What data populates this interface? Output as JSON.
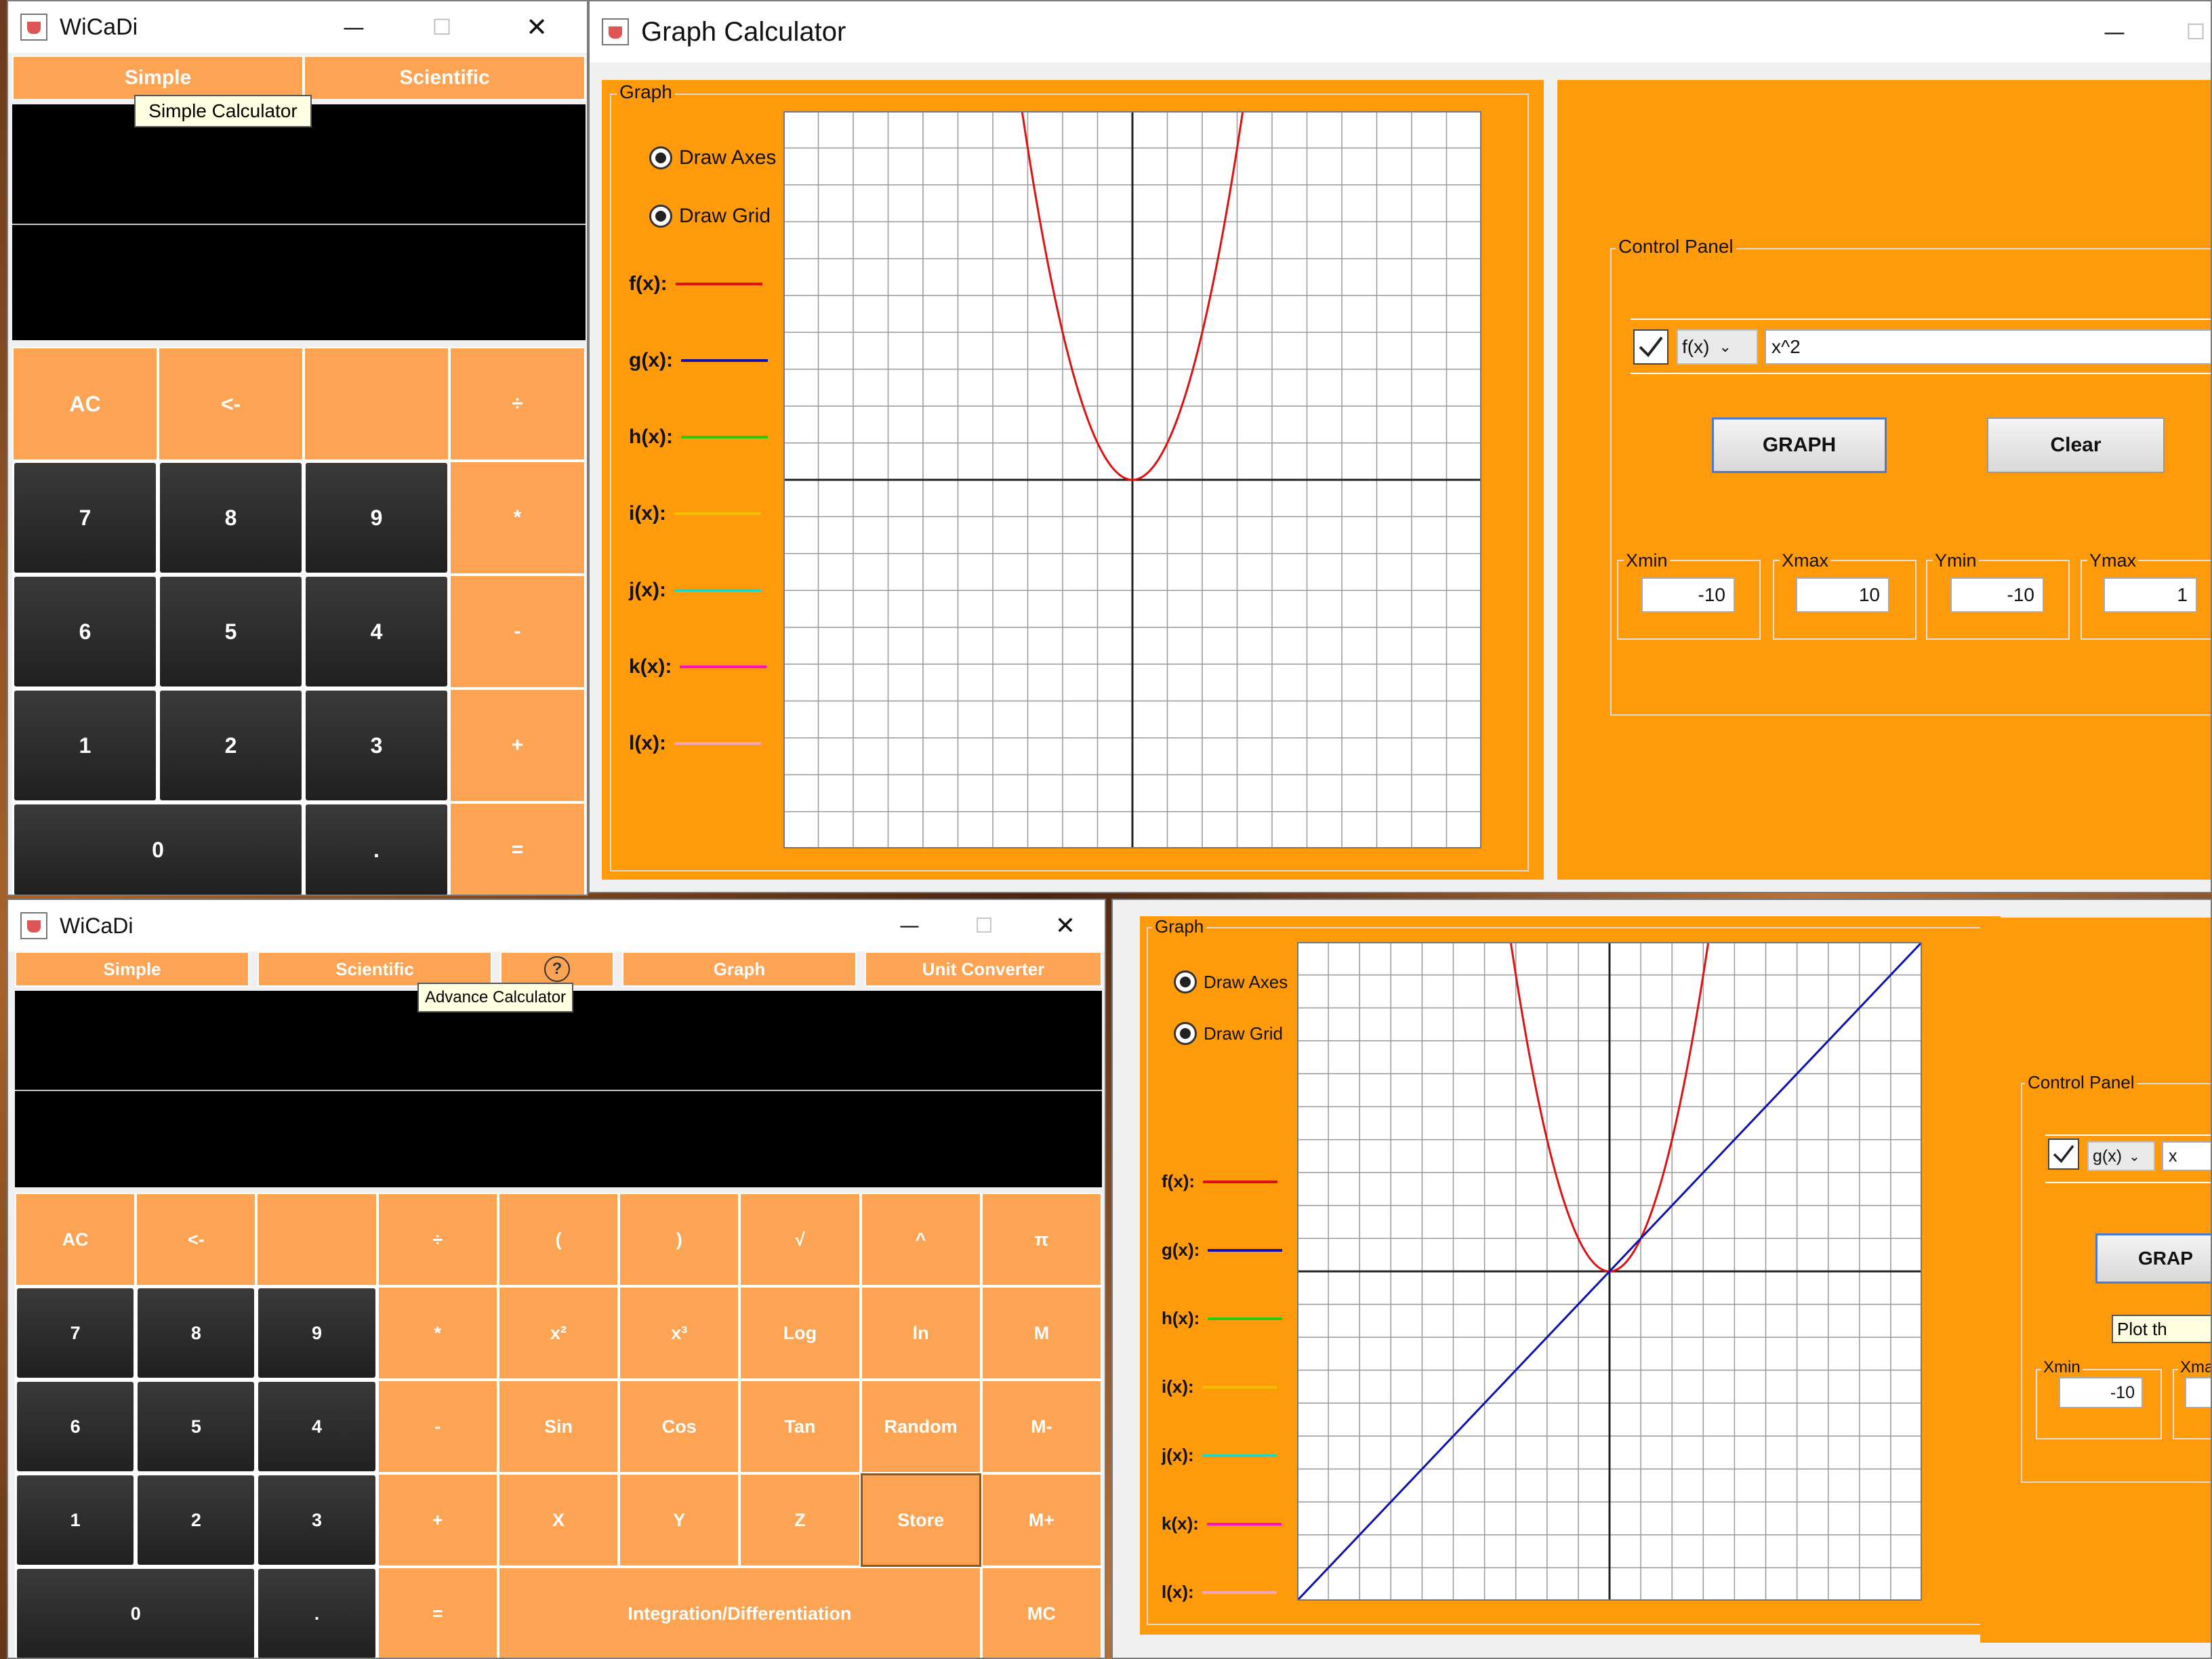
{
  "simple_window": {
    "title": "WiCaDi",
    "minimize": "—",
    "maximize": "☐",
    "close": "✕",
    "tabs": [
      "Simple",
      "Scientific"
    ],
    "tooltip": "Simple Calculator",
    "keys": [
      "AC",
      "<-",
      "",
      "÷",
      "7",
      "8",
      "9",
      "*",
      "6",
      "5",
      "4",
      "-",
      "1",
      "2",
      "3",
      "+",
      "0",
      ".",
      "="
    ]
  },
  "graph_window_top": {
    "title": "Graph Calculator",
    "minimize": "—",
    "maximize": "☐",
    "graph_legend": "Graph",
    "draw_axes": "Draw Axes",
    "draw_grid": "Draw Grid",
    "functions": [
      {
        "label": "f(x):",
        "color": "#e01010"
      },
      {
        "label": "g(x):",
        "color": "#1010b0"
      },
      {
        "label": "h(x):",
        "color": "#22cc11"
      },
      {
        "label": "i(x):",
        "color": "#f0c000"
      },
      {
        "label": "j(x):",
        "color": "#20d8c0"
      },
      {
        "label": "k(x):",
        "color": "#ff10c0"
      },
      {
        "label": "l(x):",
        "color": "#f0a8b8"
      }
    ],
    "control_panel_legend": "Control Panel",
    "fn_select": "f(x)",
    "fn_input": "x^2",
    "graph_button": "GRAPH",
    "clear_button": "Clear",
    "ranges": [
      {
        "label": "Xmin",
        "value": "-10"
      },
      {
        "label": "Xmax",
        "value": "10"
      },
      {
        "label": "Ymin",
        "value": "-10"
      },
      {
        "label": "Ymax",
        "value": "1"
      }
    ],
    "plot": {
      "xmin": -10,
      "xmax": 10,
      "ymin": -10,
      "ymax": 10,
      "curves": [
        {
          "expr": "x^2",
          "color": "#e01010"
        }
      ]
    }
  },
  "advanced_window": {
    "title": "WiCaDi",
    "minimize": "—",
    "maximize": "☐",
    "close": "✕",
    "tabs": [
      "Simple",
      "Scientific",
      "?",
      "Graph",
      "Unit Converter"
    ],
    "tooltip": "Advance Calculator",
    "keys": [
      "AC",
      "<-",
      "",
      "÷",
      "(",
      ")",
      "√",
      "^",
      "π",
      "7",
      "8",
      "9",
      "*",
      "x²",
      "x³",
      "Log",
      "ln",
      "M",
      "6",
      "5",
      "4",
      "-",
      "Sin",
      "Cos",
      "Tan",
      "Random",
      "M-",
      "1",
      "2",
      "3",
      "+",
      "X",
      "Y",
      "Z",
      "Store",
      "M+",
      "0",
      ".",
      "=",
      "Integration/Differentiation",
      "MC"
    ]
  },
  "graph_window_bottom": {
    "graph_legend": "Graph",
    "draw_axes": "Draw Axes",
    "draw_grid": "Draw Grid",
    "functions": [
      {
        "label": "f(x):",
        "color": "#e01010"
      },
      {
        "label": "g(x):",
        "color": "#1010b0"
      },
      {
        "label": "h(x):",
        "color": "#22cc11"
      },
      {
        "label": "i(x):",
        "color": "#f0c000"
      },
      {
        "label": "j(x):",
        "color": "#20d8c0"
      },
      {
        "label": "k(x):",
        "color": "#ff10c0"
      },
      {
        "label": "l(x):",
        "color": "#f0a8b8"
      }
    ],
    "control_panel_legend": "Control Panel",
    "fn_select": "g(x)",
    "fn_input": "x",
    "graph_button": "GRAP",
    "tooltip": "Plot th",
    "ranges": [
      {
        "label": "Xmin",
        "value": "-10"
      },
      {
        "label": "Xma",
        "value": ""
      }
    ],
    "plot": {
      "xmin": -10,
      "xmax": 10,
      "ymin": -10,
      "ymax": 10,
      "curves": [
        {
          "expr": "x^2",
          "color": "#e01010"
        },
        {
          "expr": "x",
          "color": "#1010b0"
        }
      ]
    }
  },
  "chart_data": [
    {
      "type": "line",
      "series": [
        {
          "name": "f(x)",
          "expr": "x^2"
        }
      ],
      "xlim": [
        -10,
        10
      ],
      "ylim": [
        -10,
        10
      ],
      "grid": true
    },
    {
      "type": "line",
      "series": [
        {
          "name": "f(x)",
          "expr": "x^2"
        },
        {
          "name": "g(x)",
          "expr": "x"
        }
      ],
      "xlim": [
        -10,
        10
      ],
      "ylim": [
        -10,
        10
      ],
      "grid": true
    }
  ]
}
